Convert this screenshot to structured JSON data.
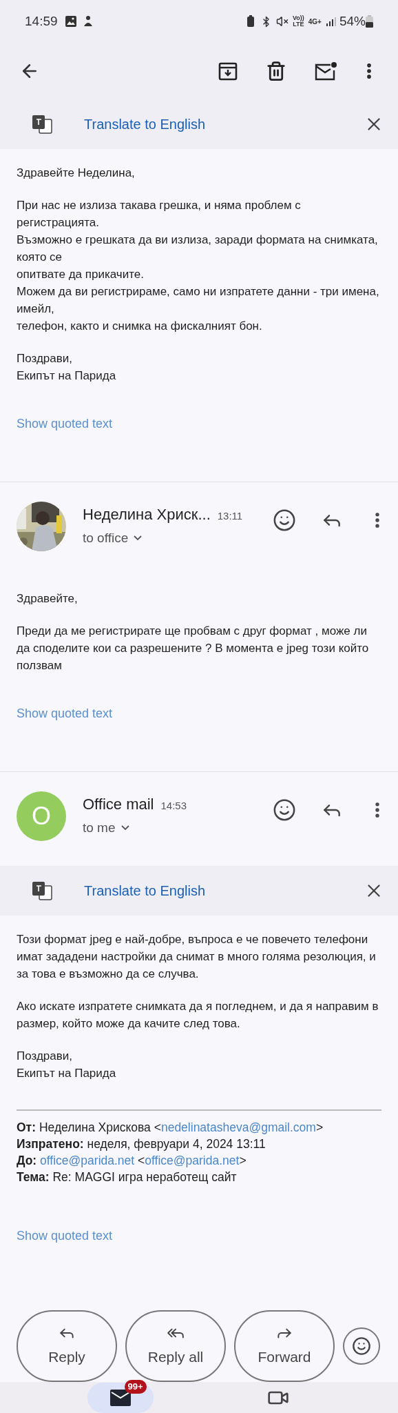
{
  "status_bar": {
    "time": "14:59",
    "indicators": [
      "Vo))",
      "LTE",
      "4G+"
    ],
    "battery": "54%"
  },
  "messages": [
    {
      "translate": {
        "label": "Translate to English"
      },
      "paragraphs": [
        "Здравейте Неделина,",
        "При нас не излиза такава грешка, и няма проблем с регистрацията.\nВъзможно е грешката да ви излиза, заради формата на снимката, която се\nопитвате да прикачите.\nМожем да ви регистрираме, само ни изпратете данни - три имена, имейл,\nтелефон, както и снимка на фискалният бон.",
        "Поздрави,\nЕкипът на Парида"
      ],
      "show_quoted": "Show quoted text"
    },
    {
      "header": {
        "sender": "Неделина Хриск...",
        "time": "13:11",
        "recipients": "to office"
      },
      "paragraphs": [
        "Здравейте,",
        "Преди да ме регистрирате ще пробвам с друг формат , може ли да споделите кои са разрешените ? В момента е jpeg този който ползвам"
      ],
      "show_quoted": "Show quoted text"
    },
    {
      "header": {
        "avatar": {
          "kind": "initial",
          "letter": "O",
          "color": "#94cc5e"
        },
        "sender": "Office mail",
        "time": "14:53",
        "recipients": "to me"
      },
      "translate": {
        "label": "Translate to English"
      },
      "paragraphs": [
        "Този формат jpeg е най-добре, въпроса е че повечето телефони имат зададени настройки да снимат в много голяма резолюция, и за това е възможно да се случва.",
        "Ако искате изпратете снимката да я погледнем, и да я направим в размер, който може да качите след това.",
        "Поздрави,\nЕкипът на Парида"
      ],
      "meta": [
        {
          "label": "От:",
          "parts": [
            {
              "kind": "plain",
              "text": "Неделина Хрискова <"
            },
            {
              "kind": "link",
              "text": "nedelinatasheva@gmail.com"
            },
            {
              "kind": "plain",
              "text": ">"
            }
          ]
        },
        {
          "label": "Изпратено:",
          "parts": [
            {
              "kind": "plain",
              "text": "неделя, февруари 4, 2024 13:11"
            }
          ]
        },
        {
          "label": "До:",
          "parts": [
            {
              "kind": "link",
              "text": "office@parida.net"
            },
            {
              "kind": "plain",
              "text": " <"
            },
            {
              "kind": "link",
              "text": "office@parida.net"
            },
            {
              "kind": "plain",
              "text": ">"
            }
          ]
        },
        {
          "label": "Тема:",
          "parts": [
            {
              "kind": "plain",
              "text": "Re: MAGGI игра неработещ сайт"
            }
          ]
        }
      ],
      "show_quoted": "Show quoted text"
    }
  ],
  "actions": [
    {
      "kind": "reply",
      "label": "Reply"
    },
    {
      "kind": "reply_all",
      "label": "Reply all"
    },
    {
      "kind": "forward",
      "label": "Forward"
    }
  ],
  "bottom_nav": [
    {
      "kind": "mail",
      "badge": "99+",
      "selected": true
    },
    {
      "kind": "meet",
      "selected": false
    }
  ]
}
